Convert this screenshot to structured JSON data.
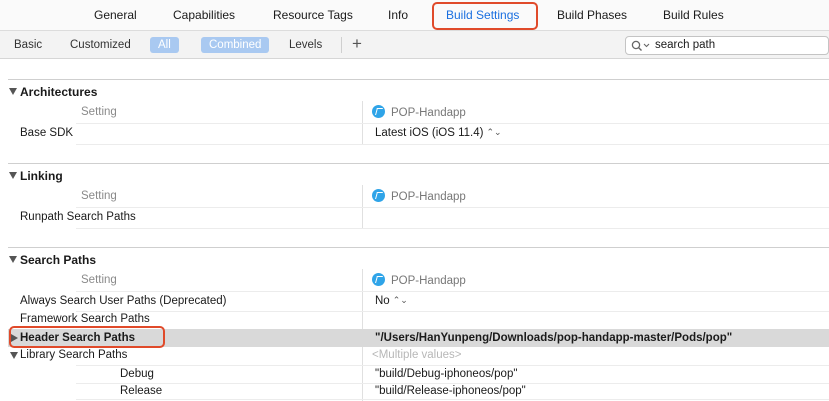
{
  "tabs": [
    {
      "label": "General"
    },
    {
      "label": "Capabilities"
    },
    {
      "label": "Resource Tags"
    },
    {
      "label": "Info"
    },
    {
      "label": "Build Settings"
    },
    {
      "label": "Build Phases"
    },
    {
      "label": "Build Rules"
    }
  ],
  "active_tab": "Build Settings",
  "filters": {
    "basic": "Basic",
    "customized": "Customized",
    "all": "All",
    "combined": "Combined",
    "levels": "Levels",
    "add": "+"
  },
  "search": {
    "value": "search path"
  },
  "colors": {
    "accent": "#1a6fe0",
    "highlight_outline": "#e04a2a",
    "segment_selected": "#a9c9f1",
    "selected_row": "#d9d9d9"
  },
  "sections": [
    {
      "title": "Architectures",
      "header_setting": "Setting",
      "target": "POP-Handapp",
      "rows": [
        {
          "name": "Base SDK",
          "value": "Latest iOS (iOS 11.4)",
          "stepper": "⌃⌄"
        }
      ]
    },
    {
      "title": "Linking",
      "header_setting": "Setting",
      "target": "POP-Handapp",
      "rows": [
        {
          "name": "Runpath Search Paths",
          "value": ""
        }
      ]
    },
    {
      "title": "Search Paths",
      "header_setting": "Setting",
      "target": "POP-Handapp",
      "rows": [
        {
          "name": "Always Search User Paths (Deprecated)",
          "value": "No",
          "stepper": "⌃⌄"
        },
        {
          "name": "Framework Search Paths",
          "value": ""
        },
        {
          "name": "Header Search Paths",
          "value": "\"/Users/HanYunpeng/Downloads/pop-handapp-master/Pods/pop\""
        },
        {
          "name": "Library Search Paths",
          "value": "<Multiple values>",
          "children": [
            {
              "name": "Debug",
              "value": "\"build/Debug-iphoneos/pop\""
            },
            {
              "name": "Release",
              "value": "\"build/Release-iphoneos/pop\""
            }
          ]
        }
      ]
    }
  ]
}
